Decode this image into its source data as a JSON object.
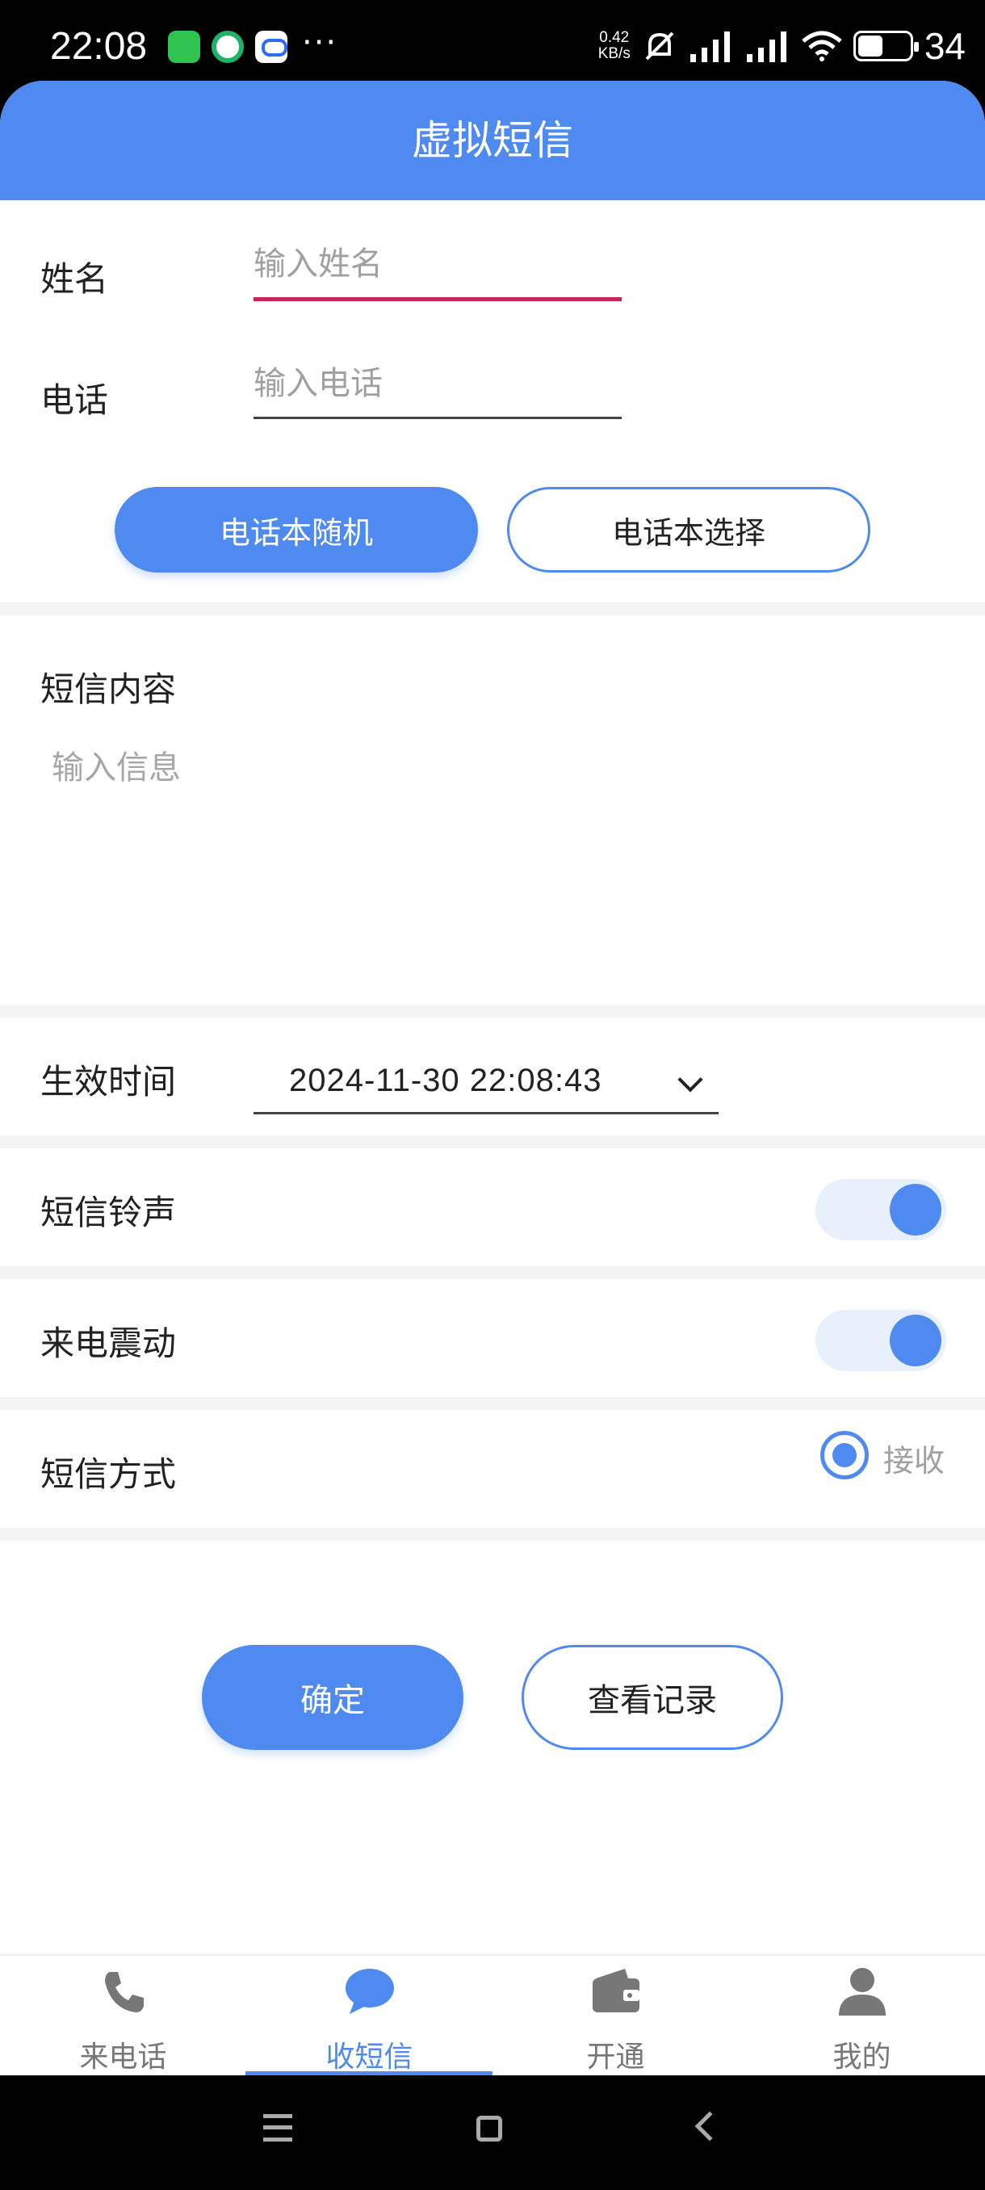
{
  "status_bar": {
    "time": "22:08",
    "dots": "···",
    "net_speed_value": "0.42",
    "net_speed_unit": "KB/s",
    "battery": "34"
  },
  "header": {
    "title": "虚拟短信"
  },
  "form": {
    "name_label": "姓名",
    "name_placeholder": "输入姓名",
    "phone_label": "电话",
    "phone_placeholder": "输入电话",
    "random_contact_button": "电话本随机",
    "select_contact_button": "电话本选择",
    "message_label": "短信内容",
    "message_placeholder": "输入信息",
    "effective_time_label": "生效时间",
    "effective_time_value": "2024-11-30 22:08:43",
    "ringtone_label": "短信铃声",
    "vibrate_label": "来电震动",
    "sms_mode_label": "短信方式",
    "sms_mode_option": "接收"
  },
  "actions": {
    "confirm_button": "确定",
    "view_records_button": "查看记录"
  },
  "bottom_nav": {
    "items": [
      {
        "label": "来电话"
      },
      {
        "label": "收短信"
      },
      {
        "label": "开通"
      },
      {
        "label": "我的"
      }
    ]
  },
  "colors": {
    "accent": "#4f8af0",
    "focus_underline": "#c8245a"
  }
}
